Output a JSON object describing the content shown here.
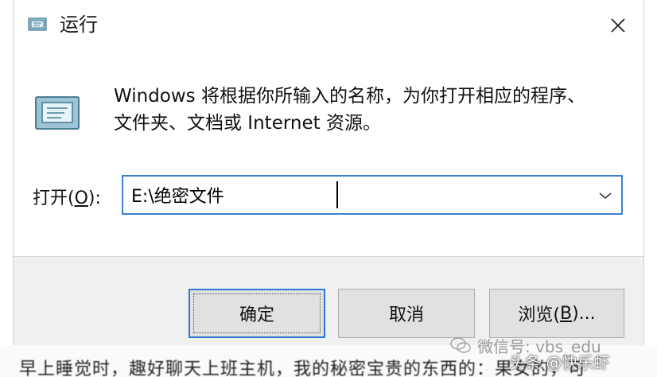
{
  "window": {
    "title": "运行",
    "close_icon": "close-icon",
    "app_icon": "run-dialog-icon"
  },
  "description": "Windows 将根据你所输入的名称，为你打开相应的程序、\n文件夹、文档或 Internet 资源。",
  "open_field": {
    "label_prefix": "打开(",
    "label_key": "O",
    "label_suffix": "):",
    "value": "E:\\绝密文件",
    "dropdown_icon": "chevron-down-icon"
  },
  "buttons": {
    "ok": "确定",
    "cancel": "取消",
    "browse_prefix": "浏览(",
    "browse_key": "B",
    "browse_suffix": ")..."
  },
  "background_text": "早上睡觉时，趣好聊天上班主机，我的秘密宝贵的东西的：果女的，可",
  "watermarks": {
    "wechat": "微信号: vbs_edu",
    "toutiao": "头条 @快乐虾"
  },
  "colors": {
    "focus_border": "#3c7fd1",
    "button_face": "#e1e1e1",
    "footer_bg": "#f0f0f0"
  }
}
